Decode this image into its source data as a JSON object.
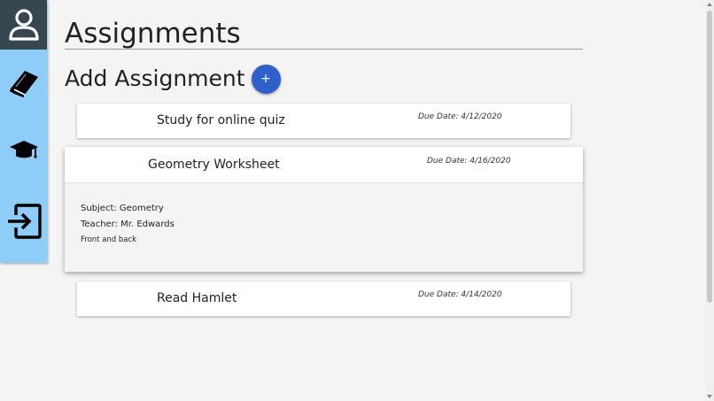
{
  "page": {
    "title": "Assignments",
    "add_label": "Add Assignment",
    "add_button_label": "+"
  },
  "sidebar": {
    "items": [
      {
        "icon": "user-icon"
      },
      {
        "icon": "book-icon"
      },
      {
        "icon": "graduation-cap-icon"
      },
      {
        "icon": "logout-icon"
      }
    ]
  },
  "assignments": [
    {
      "title": "Study for online quiz",
      "due": "Due Date: 4/12/2020",
      "expanded": false
    },
    {
      "title": "Geometry Worksheet",
      "due": "Due Date: 4/16/2020",
      "expanded": true,
      "subject": "Subject: Geometry",
      "teacher": "Teacher: Mr. Edwards",
      "notes": "Front and back"
    },
    {
      "title": "Read Hamlet",
      "due": "Due Date: 4/14/2020",
      "expanded": false
    }
  ],
  "colors": {
    "sidebar": "#8ecdf8",
    "profile_bg": "#37474f",
    "accent": "#2f5fc9",
    "background": "#f4f4f4"
  }
}
